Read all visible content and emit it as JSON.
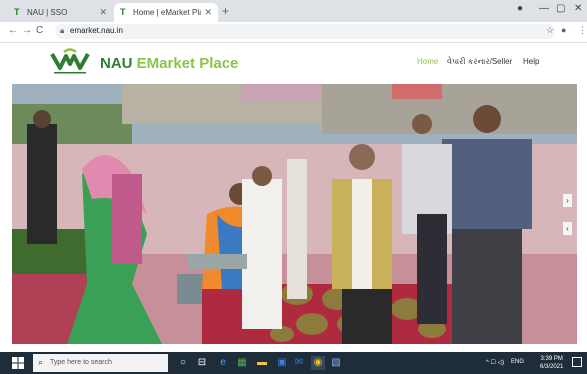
{
  "browser": {
    "tabs": [
      {
        "title": "NAU | SSO",
        "favicon": "nau-logo-icon"
      },
      {
        "title": "Home | eMarket Place Navsari A",
        "favicon": "nau-logo-icon"
      }
    ],
    "address": "emarket.nau.in"
  },
  "site": {
    "brand_nau": "NAU",
    "brand_market": "EMarket Place",
    "nav": {
      "home": "Home",
      "seller": "વેપારી કરનાર/Seller",
      "help": "Help"
    }
  },
  "taskbar": {
    "search_placeholder": "Type here to search",
    "tray_lang": "ENG",
    "time": "3:39 PM",
    "date": "6/3/2021"
  },
  "colors": {
    "brand_dark": "#2e7d32",
    "brand_light": "#8bc34a"
  }
}
